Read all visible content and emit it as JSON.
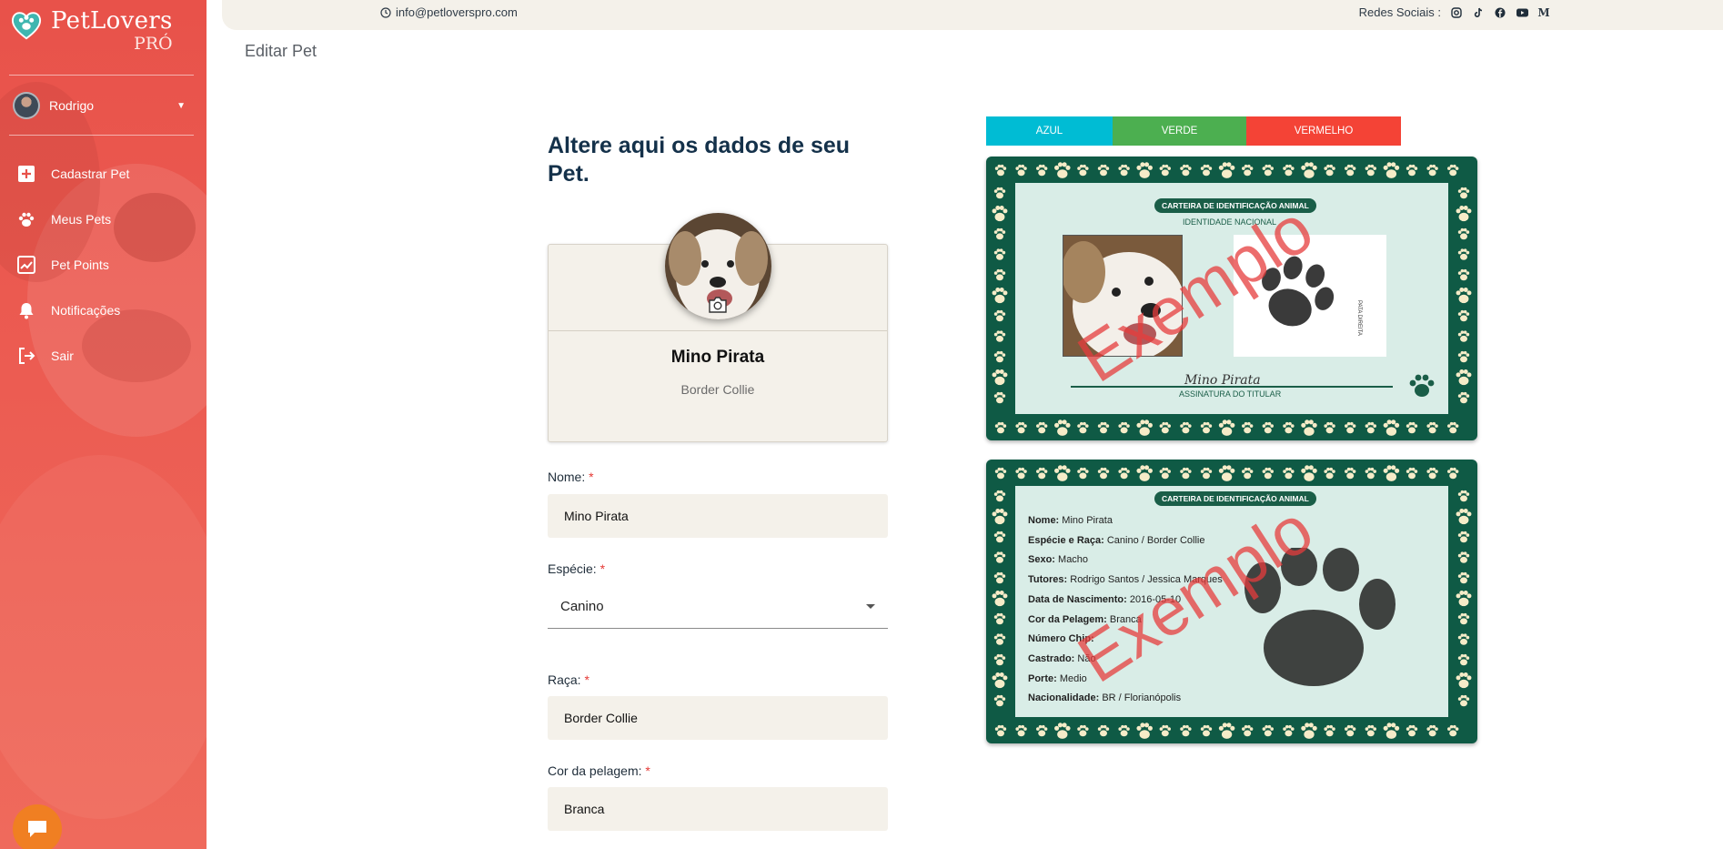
{
  "brand": {
    "name": "PetLovers",
    "suffix": "PRÓ"
  },
  "user": {
    "name": "Rodrigo"
  },
  "nav": [
    {
      "label": "Cadastrar Pet",
      "icon": "plus-square-icon"
    },
    {
      "label": "Meus Pets",
      "icon": "paw-icon"
    },
    {
      "label": "Pet Points",
      "icon": "chart-icon"
    },
    {
      "label": "Notificações",
      "icon": "bell-icon"
    },
    {
      "label": "Sair",
      "icon": "logout-icon"
    }
  ],
  "topbar": {
    "email": "info@petloverspro.com",
    "social_label": "Redes Sociais :",
    "social_icons": [
      "instagram-icon",
      "tiktok-icon",
      "facebook-icon",
      "youtube-icon",
      "medium-icon"
    ]
  },
  "page": {
    "title": "Editar Pet"
  },
  "form": {
    "heading": "Altere aqui os dados de seu Pet.",
    "pet_name": "Mino Pirata",
    "pet_breed": "Border Collie",
    "fields": {
      "nome": {
        "label": "Nome:",
        "value": "Mino Pirata"
      },
      "especie": {
        "label": "Espécie:",
        "value": "Canino"
      },
      "raca": {
        "label": "Raça:",
        "value": "Border Collie"
      },
      "cor": {
        "label": "Cor da pelagem:",
        "value": "Branca"
      }
    },
    "required_mark": "*"
  },
  "colors": {
    "buttons": [
      {
        "label": "AZUL",
        "color": "#00bcd4"
      },
      {
        "label": "VERDE",
        "color": "#4caf50"
      },
      {
        "label": "VERMELHO",
        "color": "#f44336"
      }
    ],
    "card_green": "#0f5a45",
    "sidebar_red": "#e8524a"
  },
  "card_front": {
    "badge": "CARTEIRA DE IDENTIFICAÇÃO ANIMAL",
    "subtitle": "IDENTIDADE NACIONAL",
    "pawprint_label": "PATA DIREITA",
    "signature": "Mino Pirata",
    "signature_caption": "ASSINATURA DO TITULAR",
    "watermark": "Exemplo"
  },
  "card_back": {
    "badge": "CARTEIRA DE IDENTIFICAÇÃO ANIMAL",
    "watermark": "Exemplo",
    "rows": [
      {
        "label": "Nome:",
        "value": "Mino Pirata"
      },
      {
        "label": "Espécie e Raça:",
        "value": "Canino / Border Collie"
      },
      {
        "label": "Sexo:",
        "value": "Macho"
      },
      {
        "label": "Tutores:",
        "value": "Rodrigo Santos / Jessica Marques"
      },
      {
        "label": "Data de Nascimento:",
        "value": "2016-05-10"
      },
      {
        "label": "Cor da Pelagem:",
        "value": "Branca"
      },
      {
        "label": "Número Chip:",
        "value": ""
      },
      {
        "label": "Castrado:",
        "value": "Não"
      },
      {
        "label": "Porte:",
        "value": "Medio"
      },
      {
        "label": "Nacionalidade:",
        "value": "BR / Florianópolis"
      }
    ]
  }
}
